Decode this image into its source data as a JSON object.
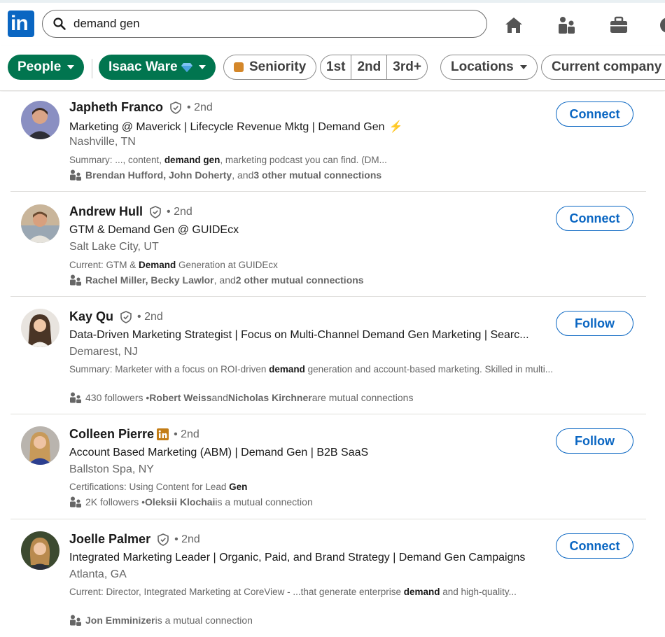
{
  "nav": {
    "logo_text": "in",
    "search_value": "demand gen",
    "icons": [
      "home-icon",
      "my-network-icon",
      "jobs-icon",
      "messaging-icon"
    ]
  },
  "filters": {
    "people": "People",
    "account": "Isaac Ware",
    "seniority": "Seniority",
    "degrees": [
      "1st",
      "2nd",
      "3rd+"
    ],
    "locations": "Locations",
    "current_company": "Current company"
  },
  "results": [
    {
      "name": "Japheth Franco",
      "degree": "• 2nd",
      "headline": "Marketing @ Maverick | Lifecycle Revenue Mktg | Demand Gen",
      "location": "Nashville, TN",
      "snippet_pre": "Summary: ..., content, ",
      "snippet_bold": "demand gen",
      "snippet_post": ", marketing podcast you can find. (DM...",
      "mutual_bold1": "Brendan Hufford, John Doherty",
      "mutual_mid": ", and ",
      "mutual_bold2": "3 other mutual connections",
      "mutual_post": "",
      "action": "Connect"
    },
    {
      "name": "Andrew Hull",
      "degree": "• 2nd",
      "headline": "GTM & Demand Gen @ GUIDEcx",
      "location": "Salt Lake City, UT",
      "snippet_pre": "Current: GTM & ",
      "snippet_bold": "Demand",
      "snippet_post": " Generation at GUIDEcx",
      "mutual_bold1": "Rachel Miller, Becky Lawlor",
      "mutual_mid": ", and ",
      "mutual_bold2": "2 other mutual connections",
      "mutual_post": "",
      "action": "Connect"
    },
    {
      "name": "Kay Qu",
      "degree": "• 2nd",
      "headline": "Data-Driven Marketing Strategist | Focus on Multi-Channel Demand Gen Marketing | Searc...",
      "location": "Demarest, NJ",
      "snippet_pre": "Summary: Marketer with a focus on ROI-driven ",
      "snippet_bold": "demand",
      "snippet_post": " generation and account-based marketing. Skilled in multi...",
      "mutual_pre": "430 followers • ",
      "mutual_bold1": "Robert Weiss",
      "mutual_mid": " and ",
      "mutual_bold2": "Nicholas Kirchner",
      "mutual_post": " are mutual connections",
      "action": "Follow"
    },
    {
      "name": "Colleen Pierre",
      "degree": "• 2nd",
      "headline": "Account Based Marketing (ABM) | Demand Gen | B2B SaaS",
      "location": "Ballston Spa, NY",
      "snippet_pre": "Certifications: Using Content for Lead ",
      "snippet_bold": "Gen",
      "snippet_post": "",
      "mutual_pre": "2K followers • ",
      "mutual_bold1": "Oleksii Klochai",
      "mutual_mid": "",
      "mutual_bold2": "",
      "mutual_post": " is a mutual connection",
      "action": "Follow"
    },
    {
      "name": "Joelle Palmer",
      "degree": "• 2nd",
      "headline": "Integrated Marketing Leader | Organic, Paid, and Brand Strategy | Demand Gen Campaigns",
      "location": "Atlanta, GA",
      "snippet_pre": "Current: Director, Integrated Marketing at CoreView - ...that generate enterprise ",
      "snippet_bold": "demand",
      "snippet_post": " and high-quality...",
      "mutual_bold1": "Jon Emminizer",
      "mutual_mid": "",
      "mutual_bold2": "",
      "mutual_post": " is a mutual connection",
      "action": "Connect"
    }
  ],
  "colors": {
    "brand_blue": "#0a66c2",
    "filter_green": "#01754f"
  }
}
